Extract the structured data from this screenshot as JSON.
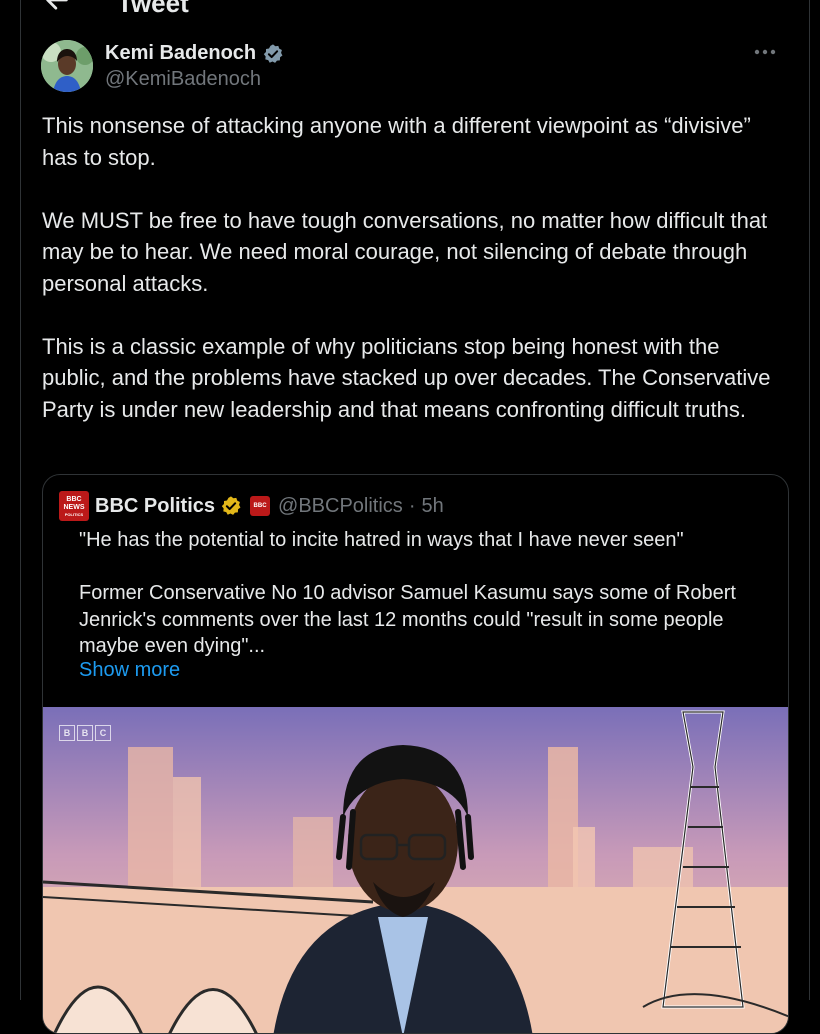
{
  "header": {
    "title": "Tweet"
  },
  "author": {
    "display_name": "Kemi Badenoch",
    "handle": "@KemiBadenoch"
  },
  "tweet": {
    "paragraphs": [
      "This nonsense of attacking anyone with a different viewpoint as “divisive” has to stop.",
      "We MUST be free to have tough conversations, no matter how difficult that may be to hear. We need moral courage, not silencing of debate through personal attacks.",
      "This is a classic example of why politicians stop being honest with the public, and the problems have stacked up over decades. The Conservative Party is under new leadership and that means confronting difficult truths."
    ]
  },
  "quote": {
    "logo_text": [
      "BBC",
      "NEWS",
      "POLITICS"
    ],
    "name": "BBC Politics",
    "handle": "@BBCPolitics",
    "separator": "·",
    "time": "5h",
    "paragraphs": [
      "\"He has the potential to incite hatred in ways that I have never seen\"",
      "Former Conservative No 10 advisor Samuel Kasumu says some of Robert Jenrick's comments over the last 12 months could \"result in some people maybe even dying\"..."
    ],
    "show_more": "Show more",
    "media": {
      "watermark": [
        "B",
        "B",
        "C"
      ]
    }
  },
  "colors": {
    "background": "#000000",
    "text": "#e7e9ea",
    "secondary": "#71767b",
    "link": "#1d9bf0",
    "verified": "#829aab",
    "gold": "#e2b719",
    "bbc_red": "#bb1919"
  },
  "icons": {
    "back": "arrow-left-icon",
    "verified": "verified-badge-icon",
    "more": "more-horizontal-icon",
    "gold_badge": "gold-verified-badge-icon"
  }
}
